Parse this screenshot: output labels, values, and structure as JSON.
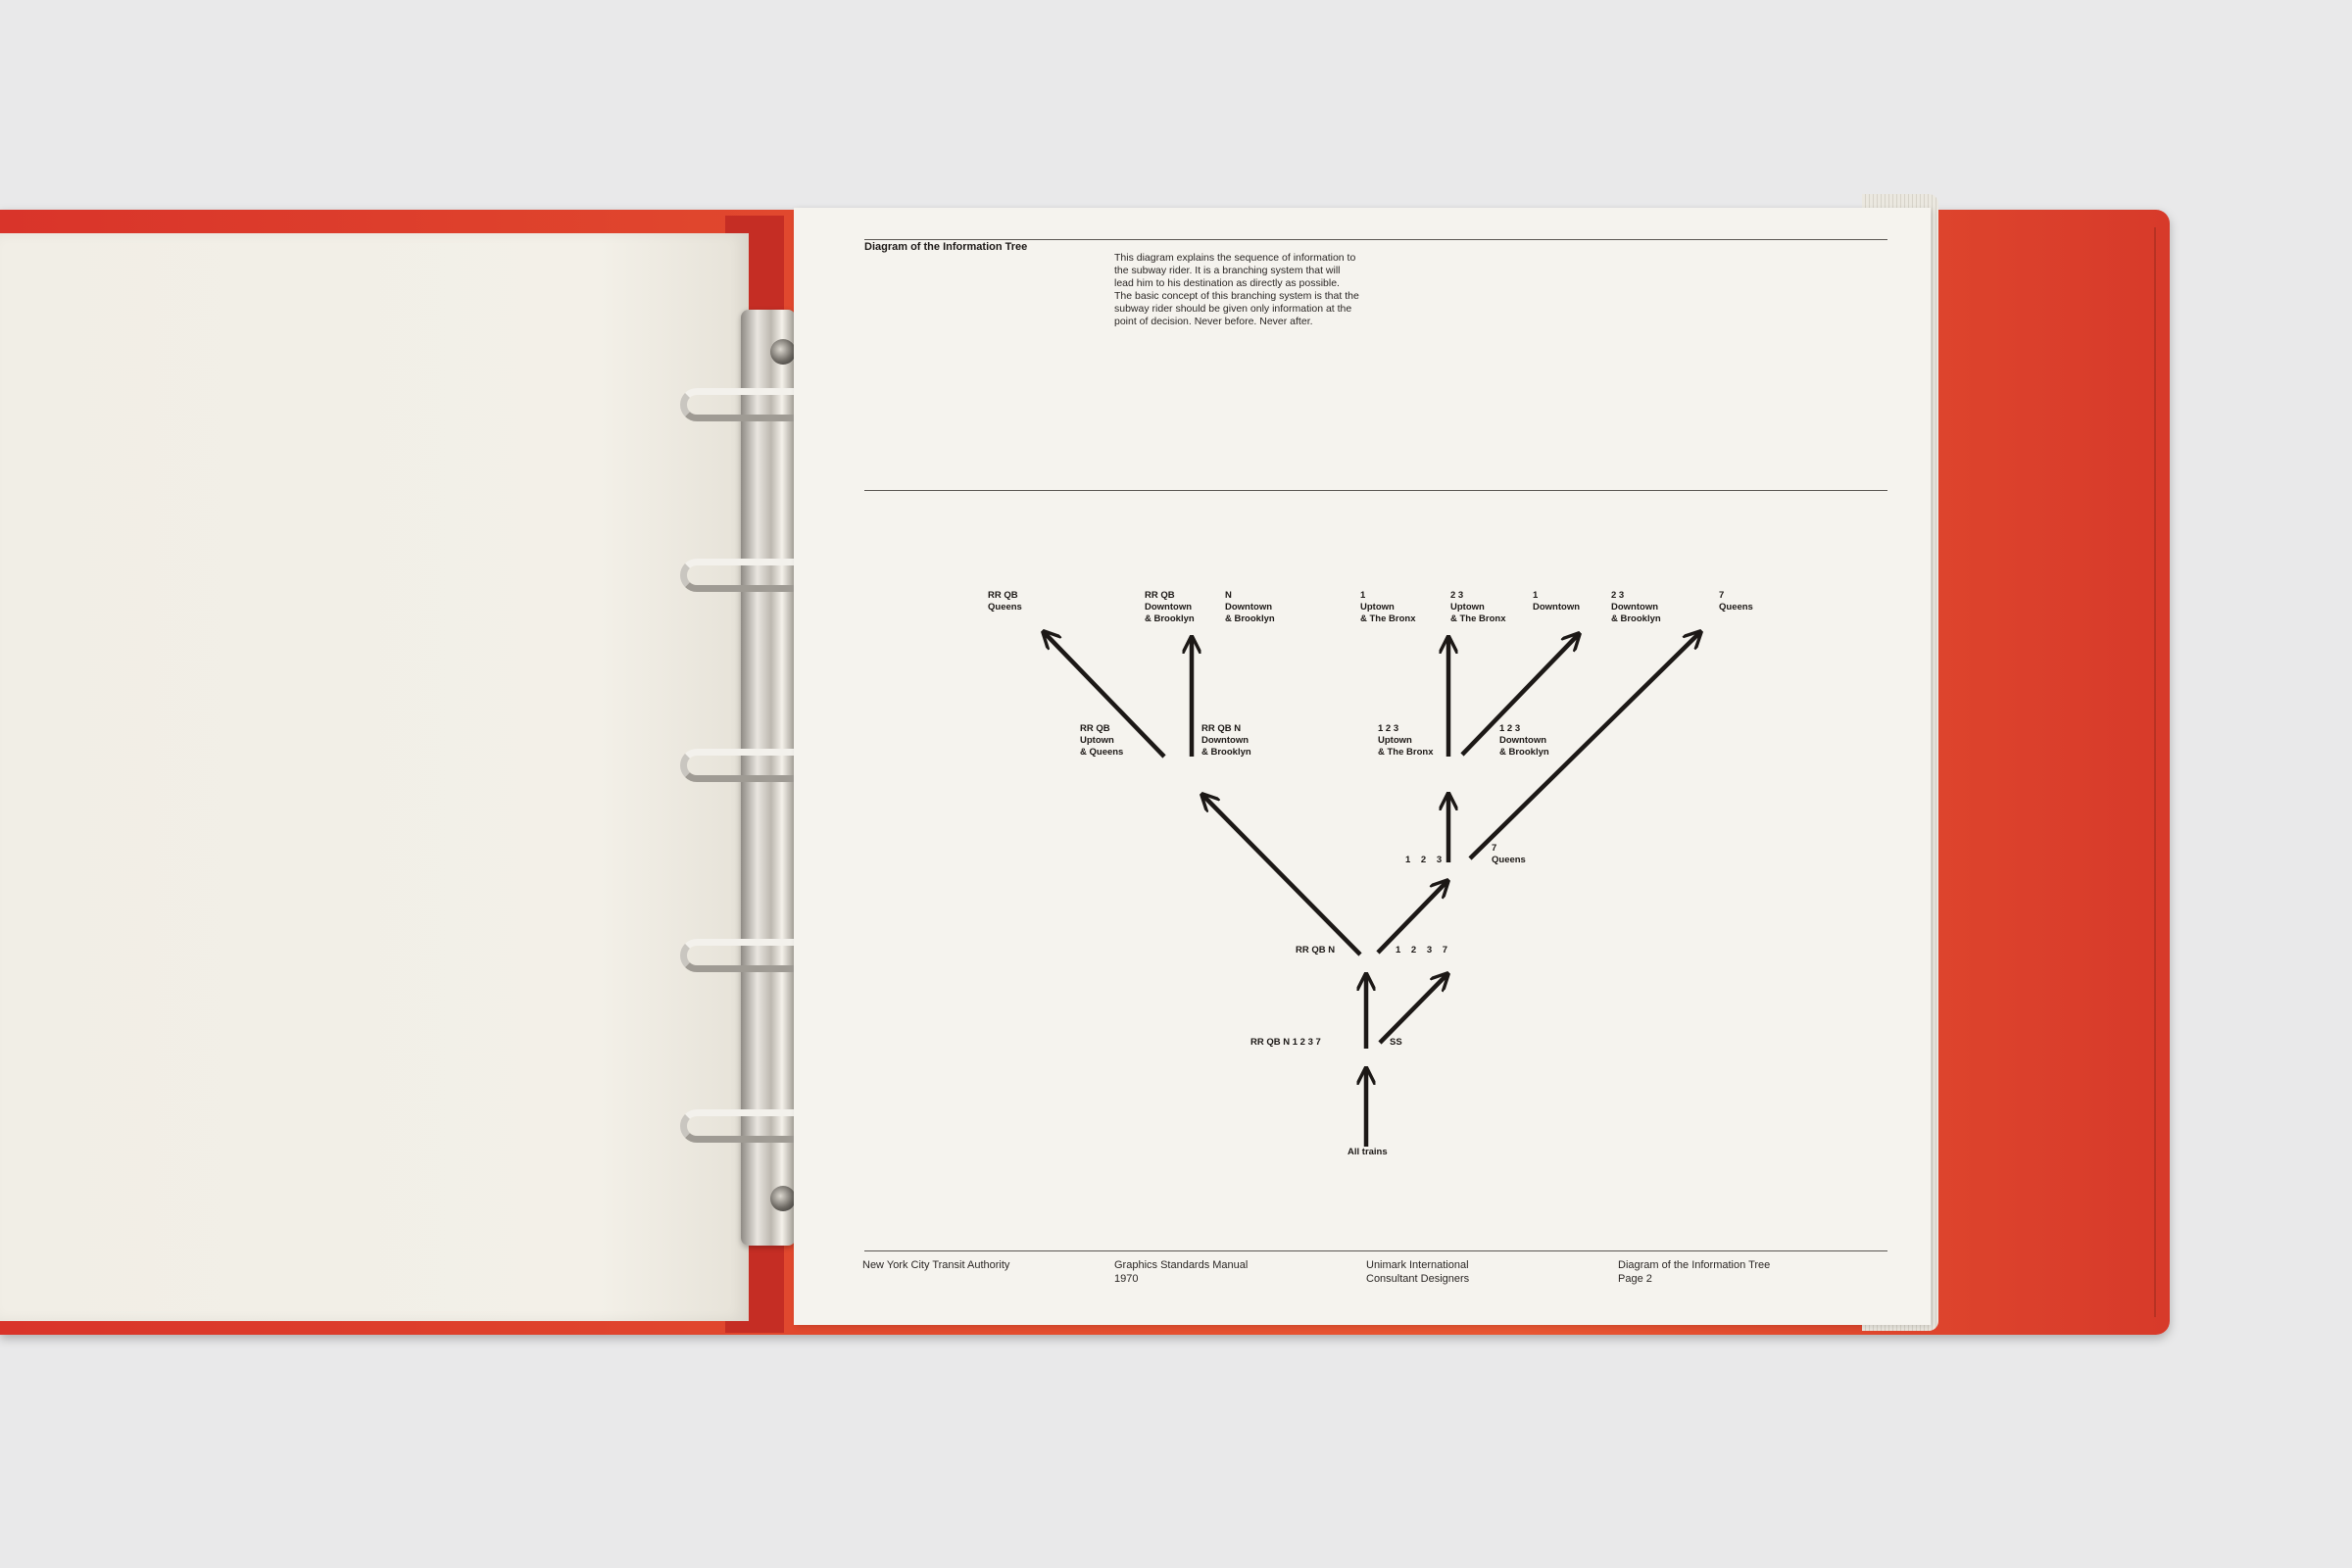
{
  "page": {
    "header_title": "Diagram of the Information Tree",
    "description": "This diagram explains the sequence of information to the subway rider. It is a branching system that will lead him to his destination as directly as possible. The basic concept of this branching system is that the subway rider should be given only information at the point of decision. Never before. Never after.",
    "footer": [
      "New York City Transit Authority",
      "Graphics Standards Manual\n1970",
      "Unimark International\nConsultant Designers",
      "Diagram of the Information Tree\nPage 2"
    ]
  },
  "diagram": {
    "labels": {
      "all_trains": "All trains",
      "lvl1_left": "RR QB N 1 2 3 7",
      "lvl1_right": "SS",
      "lvl2_left": "RR QB N",
      "lvl2_right": "1 2 3 7",
      "lvl3_123": "1 2 3",
      "lvl3_7": "7\nQueens",
      "lvl4_rrqb": "RR QB\nUptown\n& Queens",
      "lvl4_rrqbn": "RR QB N\nDowntown\n& Brooklyn",
      "lvl4_123_up": "1 2 3\nUptown\n& The Bronx",
      "lvl4_123_down": "1 2 3\nDowntown\n& Brooklyn",
      "top_rrqb_queens": "RR QB\nQueens",
      "top_rrqb_down": "RR QB\nDowntown\n& Brooklyn",
      "top_n_down": "N\nDowntown\n& Brooklyn",
      "top_1_up": "1\nUptown\n& The Bronx",
      "top_23_up": "2 3\nUptown\n& The Bronx",
      "top_1_down": "1\nDowntown",
      "top_23_down": "2 3\nDowntown\n& Brooklyn",
      "top_7_queens": "7\nQueens"
    }
  }
}
